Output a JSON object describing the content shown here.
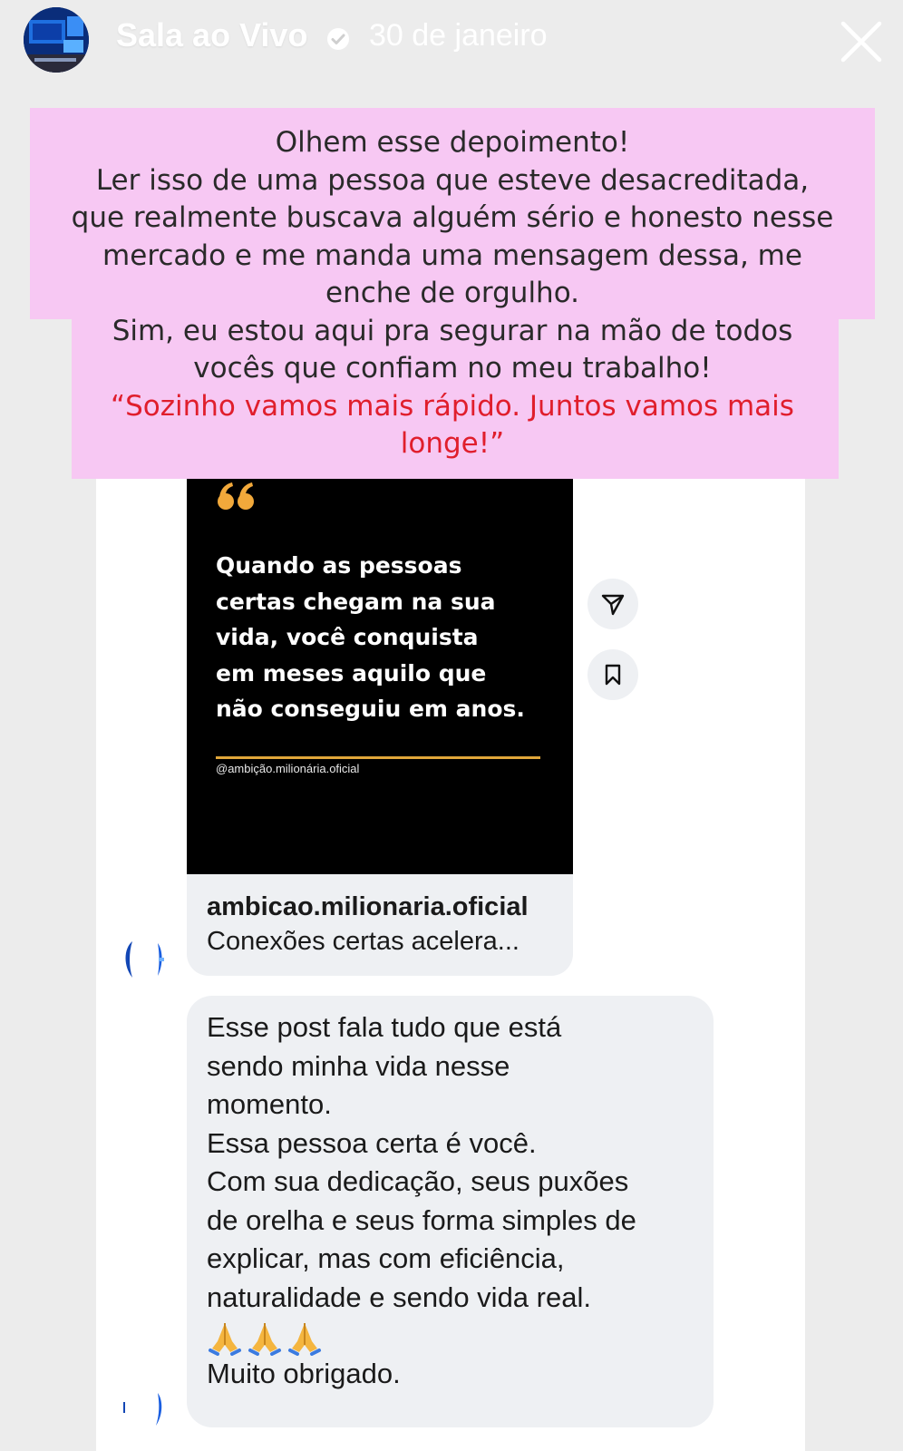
{
  "header": {
    "username": "Sala ao Vivo",
    "date": "30 de janeiro",
    "verified_icon": "verified-badge-icon",
    "close_icon": "close-icon"
  },
  "caption": {
    "lines": [
      "Olhem esse depoimento!",
      "Ler isso de uma pessoa que esteve desacreditada,",
      "que realmente buscava alguém sério e honesto nesse",
      "mercado e me manda uma mensagem dessa, me",
      "enche de orgulho.",
      "Sim, eu estou aqui pra segurar na mão de todos",
      "vocês que confiam no meu trabalho!"
    ],
    "quote_lines": [
      "“Sozinho vamos mais rápido. Juntos vamos mais",
      "longe!”"
    ],
    "background_color": "#f7c8f3",
    "quote_color": "#e01e2c"
  },
  "shared_post": {
    "quote_lines": [
      "Quando as pessoas",
      "certas chegam na sua",
      "vida, você conquista",
      "em meses aquilo que",
      "não conseguiu em anos."
    ],
    "handle": "@ambição.milionária.oficial",
    "account": "ambicao.milionaria.oficial",
    "preview": "Conexões certas acelera...",
    "accent_color": "#e0a63a"
  },
  "actions": {
    "share_icon": "send-icon",
    "save_icon": "bookmark-icon"
  },
  "message": {
    "paragraphs": [
      [
        "Esse post fala tudo que está",
        "sendo minha vida nesse",
        "momento."
      ],
      [
        "Essa pessoa certa é você."
      ],
      [
        "Com sua dedicação, seus puxões",
        "de orelha e seus forma simples de",
        "explicar, mas com eficiência,",
        "naturalidade e sendo vida real."
      ]
    ],
    "emoji": "folded-hands-emoji",
    "closing": "Muito obrigado."
  }
}
